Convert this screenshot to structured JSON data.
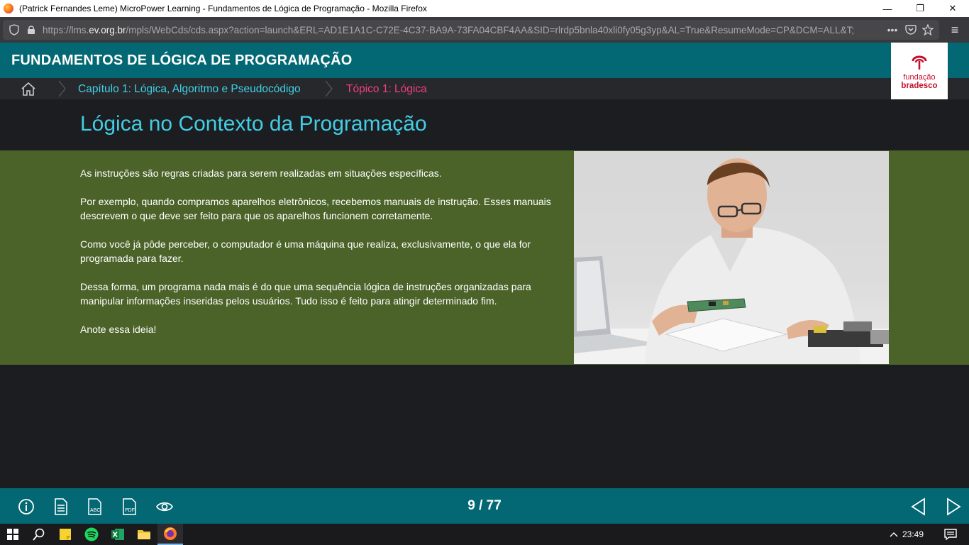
{
  "browser": {
    "window_title": "(Patrick Fernandes Leme) MicroPower Learning - Fundamentos de Lógica de Programação - Mozilla Firefox",
    "url_prefix": "https://lms.",
    "url_domain": "ev.org.br",
    "url_path": "/mpls/WebCds/cds.aspx?action=launch&ERL=AD1E1A1C-C72E-4C37-BA9A-73FA04CBF4AA&SID=rlrdp5bnla40xli0fy05g3yp&AL=True&ResumeMode=CP&DCM=ALL&T;",
    "more_dots": "•••",
    "minimize": "—",
    "restore": "❐",
    "close": "✕"
  },
  "header": {
    "title": "FUNDAMENTOS DE LÓGICA DE PROGRAMAÇÃO",
    "brand_line1": "fundação",
    "brand_line2": "bradesco"
  },
  "breadcrumb": {
    "chapter": "Capítulo 1: Lógica, Algoritmo e Pseudocódigo",
    "topic": "Tópico 1: Lógica"
  },
  "page": {
    "heading": "Lógica no Contexto da Programação",
    "paragraphs": [
      "As instruções são regras criadas para serem realizadas em situações específicas.",
      "Por exemplo, quando compramos aparelhos eletrônicos, recebemos manuais de instrução. Esses manuais descrevem o que deve ser feito para que os aparelhos funcionem corretamente.",
      "Como você já pôde perceber, o computador é uma máquina que realiza, exclusivamente, o que ela for programada para fazer.",
      "Dessa forma, um programa nada mais é do que uma sequência lógica de instruções organizadas para manipular informações inseridas pelos usuários. Tudo isso é feito para atingir determinado fim.",
      "Anote essa ideia!"
    ]
  },
  "footer": {
    "pager": "9 / 77",
    "tools": [
      "info-icon",
      "document-icon",
      "glossary-icon",
      "pdf-icon",
      "eye-icon"
    ],
    "abc_label": "ABC",
    "pdf_label": "PDF"
  },
  "taskbar": {
    "time": "23:49"
  },
  "colors": {
    "teal": "#036873",
    "olive": "#4b6329",
    "heading_cyan": "#43cde3",
    "topic_pink": "#f1407a",
    "brand_red": "#c8102e"
  }
}
